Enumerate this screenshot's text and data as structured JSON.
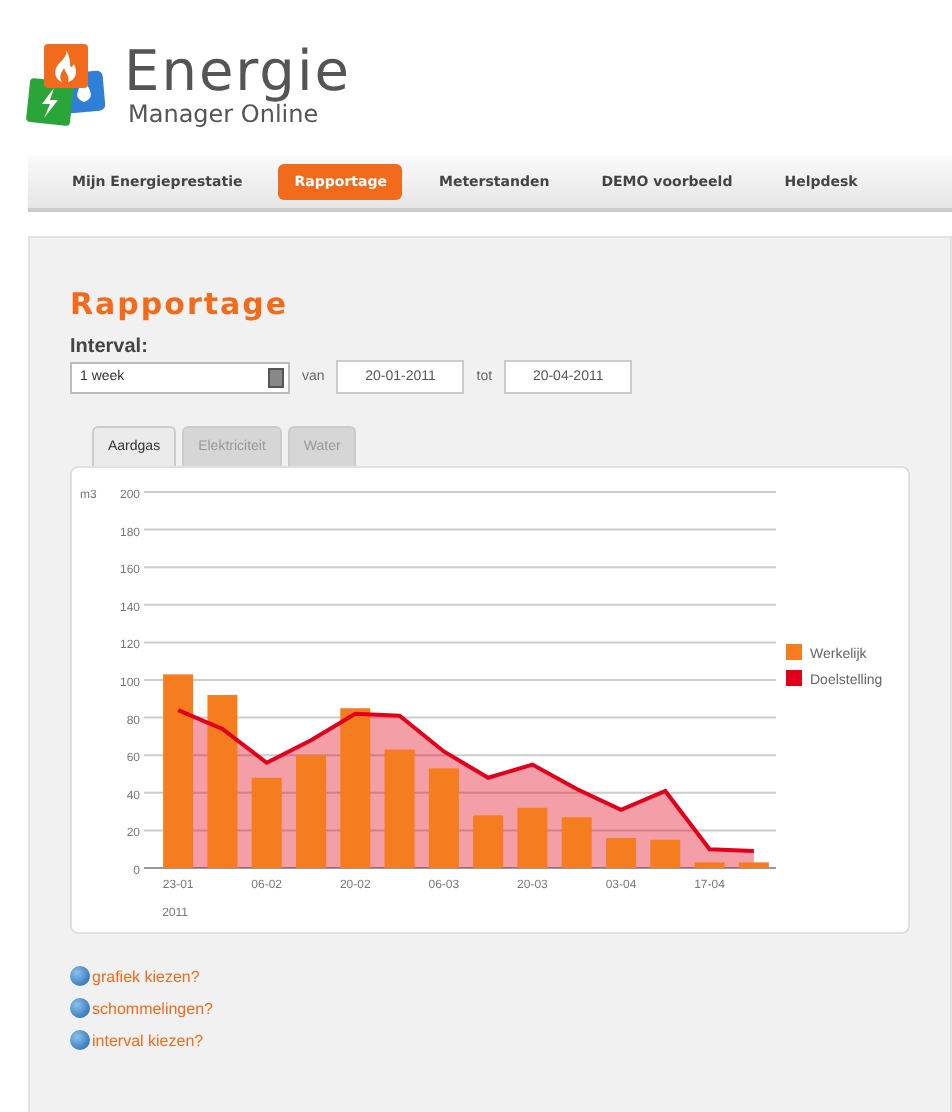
{
  "logo": {
    "title": "Energie",
    "subtitle": "Manager Online"
  },
  "nav": [
    {
      "label": "Mijn Energieprestatie",
      "selected": false
    },
    {
      "label": "Rapportage",
      "selected": true
    },
    {
      "label": "Meterstanden",
      "selected": false
    },
    {
      "label": "DEMO voorbeeld",
      "selected": false
    },
    {
      "label": "Helpdesk",
      "selected": false
    }
  ],
  "heading": "Rapportage",
  "interval": {
    "label": "Interval:",
    "value": "1 week",
    "from_label": "van",
    "from": "20-01-2011",
    "to_label": "tot",
    "to": "20-04-2011"
  },
  "tabs": [
    {
      "label": "Aardgas",
      "selected": true
    },
    {
      "label": "Elektriciteit",
      "selected": false
    },
    {
      "label": "Water",
      "selected": false
    }
  ],
  "chart": {
    "year_label": "2011",
    "chart_data": {
      "type": "bar",
      "grid": true,
      "legend": "right",
      "ylabel": "m3",
      "categories": [
        "23-01",
        null,
        "06-02",
        null,
        "20-02",
        null,
        "06-03",
        null,
        "20-03",
        null,
        "03-04",
        null,
        "17-04",
        null
      ],
      "ylim": [
        0,
        200
      ],
      "yticks": [
        0,
        20,
        40,
        60,
        80,
        100,
        120,
        140,
        160,
        180,
        200
      ],
      "series": [
        {
          "name": "Werkelijk",
          "color": "#f57d20",
          "type": "bar",
          "values": [
            103,
            92,
            48,
            60,
            85,
            63,
            53,
            28,
            32,
            27,
            16,
            15,
            3,
            3
          ]
        },
        {
          "name": "Doelstelling",
          "color": "#e3001b",
          "type": "area",
          "values": [
            84,
            74,
            56,
            68,
            82,
            81,
            62,
            48,
            55,
            42,
            31,
            41,
            10,
            9
          ]
        }
      ]
    }
  },
  "help_links": [
    "grafiek kiezen?",
    "schommelingen?",
    "interval kiezen?"
  ]
}
